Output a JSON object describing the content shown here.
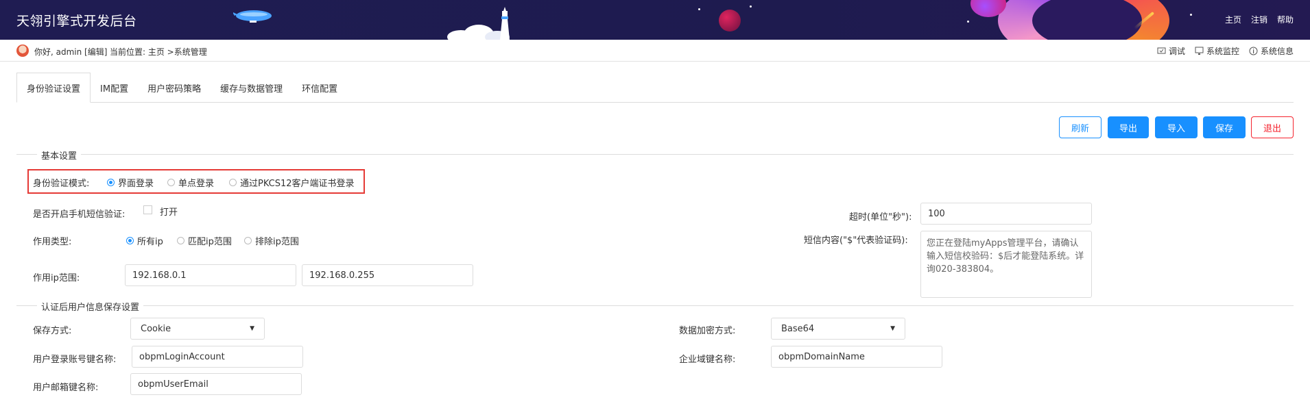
{
  "header": {
    "app_title": "天翎引擎式开发后台",
    "nav": [
      "主页",
      "注销",
      "帮助"
    ]
  },
  "subbar": {
    "greeting": "你好, admin [编辑]",
    "breadcrumb": "当前位置: 主页 >系统管理",
    "tools": [
      {
        "label": "调试",
        "icon": "debug-icon"
      },
      {
        "label": "系统监控",
        "icon": "monitor-icon"
      },
      {
        "label": "系统信息",
        "icon": "info-icon"
      }
    ]
  },
  "tabs": [
    "身份验证设置",
    "IM配置",
    "用户密码策略",
    "缓存与数据管理",
    "环信配置"
  ],
  "actions": {
    "refresh": "刷新",
    "export": "导出",
    "import": "导入",
    "save": "保存",
    "exit": "退出"
  },
  "basic": {
    "section_title": "基本设置",
    "auth_mode_label": "身份验证模式:",
    "auth_modes": [
      "界面登录",
      "单点登录",
      "通过PKCS12客户端证书登录"
    ],
    "auth_mode_selected": "界面登录",
    "sms_label": "是否开启手机短信验证:",
    "sms_option": "打开",
    "scope_type_label": "作用类型:",
    "scope_types": [
      "所有ip",
      "匹配ip范围",
      "排除ip范围"
    ],
    "scope_type_selected": "所有ip",
    "ip_range_label": "作用ip范围:",
    "ip_start": "192.168.0.1",
    "ip_end": "192.168.0.255",
    "timeout_label": "超时(单位\"秒\"):",
    "timeout_value": "100",
    "sms_content_label": "短信内容(\"$\"代表验证码):",
    "sms_content_value": "您正在登陆myApps管理平台，请确认输入短信校验码：$后才能登陆系统。详询020-383804。"
  },
  "storage": {
    "section_title": "认证后用户信息保存设置",
    "save_method_label": "保存方式:",
    "save_method_value": "Cookie",
    "encrypt_label": "数据加密方式:",
    "encrypt_value": "Base64",
    "account_key_label": "用户登录账号键名称:",
    "account_key_value": "obpmLoginAccount",
    "domain_key_label": "企业域键名称:",
    "domain_key_value": "obpmDomainName",
    "email_key_label": "用户邮箱键名称:",
    "email_key_value": "obpmUserEmail"
  },
  "colors": {
    "header_bg": "#1f1c52",
    "primary": "#1890ff",
    "danger": "#f5222d",
    "highlight": "#e53935"
  }
}
